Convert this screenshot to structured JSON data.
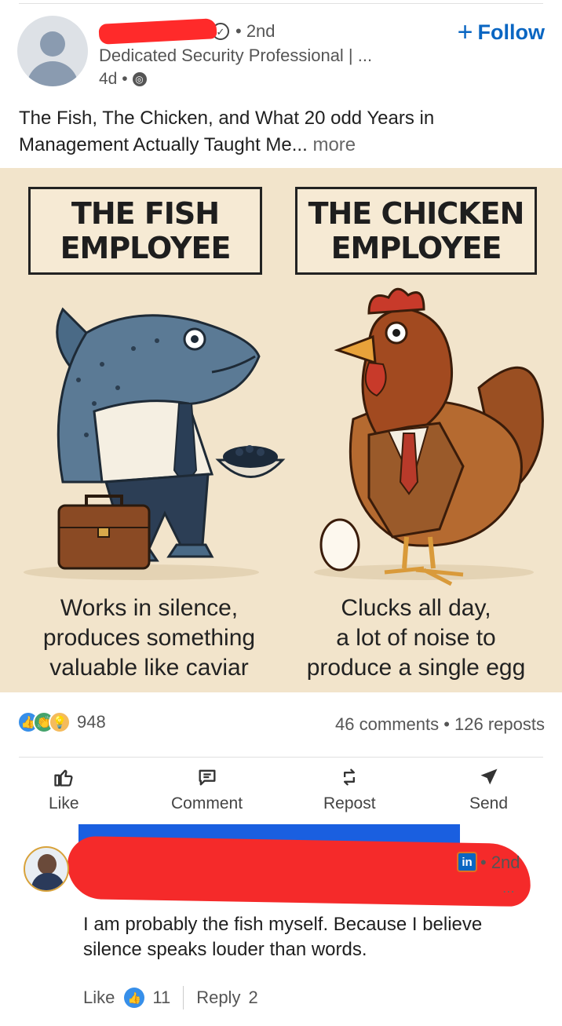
{
  "post": {
    "author": {
      "degree": "• 2nd",
      "headline": "Dedicated Security Professional | ...",
      "age": "4d •"
    },
    "follow_label": "Follow",
    "text": "The Fish, The Chicken, and What 20 odd Years in Management Actually Taught Me...",
    "more_label": " more"
  },
  "image": {
    "left_title_line1": "THE FISH",
    "left_title_line2": "EMPLOYEE",
    "right_title_line1": "THE CHICKEN",
    "right_title_line2": "EMPLOYEE",
    "left_caption_line1": "Works in silence,",
    "left_caption_line2": "produces something",
    "left_caption_line3": "valuable like caviar",
    "right_caption_line1": "Clucks all day,",
    "right_caption_line2": "a lot of noise to",
    "right_caption_line3": "produce a single egg"
  },
  "social": {
    "reaction_count": "948",
    "stats": "46 comments • 126 reposts",
    "reaction_icons": [
      "like-icon",
      "celebrate-icon",
      "insightful-icon"
    ]
  },
  "actions": {
    "like": "Like",
    "comment": "Comment",
    "repost": "Repost",
    "send": "Send"
  },
  "comment": {
    "degree": "• 2nd",
    "badge": "in",
    "text": "I am probably the fish myself. Because I believe silence speaks louder than words.",
    "like_label": "Like",
    "like_count": "11",
    "reply_label": "Reply",
    "reply_count": "2"
  },
  "colors": {
    "accent": "#0a66c2",
    "redaction": "#ff2a2a",
    "image_bg": "#f2e4cb"
  }
}
